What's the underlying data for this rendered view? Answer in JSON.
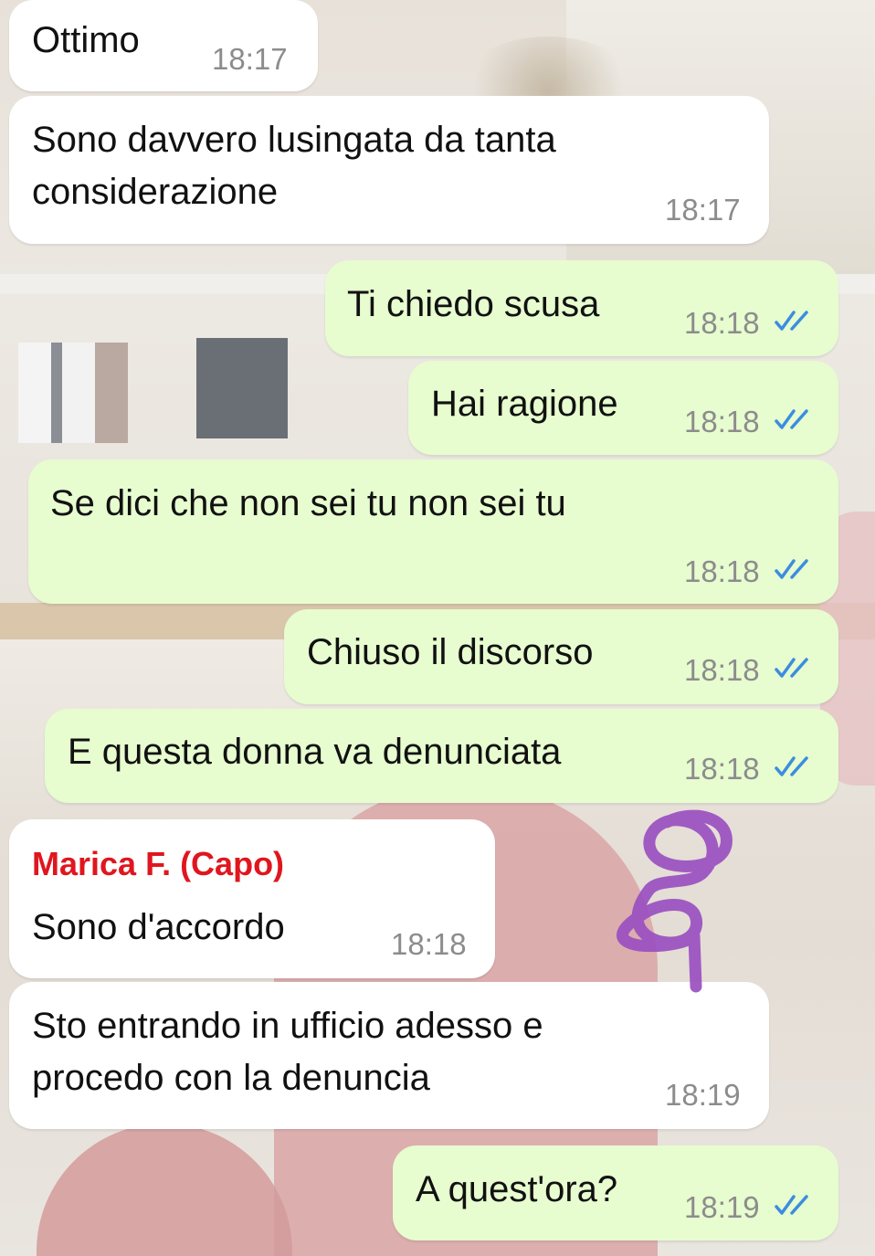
{
  "theme": {
    "incoming_bubble": "#ffffff",
    "outgoing_bubble": "#e7fccf",
    "sender_color": "#e0161f",
    "read_ticks_color": "#3b8de0",
    "scribble_color": "#9a4fc0"
  },
  "messages": [
    {
      "text": "Ottimo",
      "time": "18:17",
      "direction": "incoming"
    },
    {
      "text": "Sono davvero lusingata da tanta\nconsiderazione",
      "time": "18:17",
      "direction": "incoming"
    },
    {
      "text": "Ti chiedo scusa",
      "time": "18:18",
      "direction": "outgoing",
      "status": "read"
    },
    {
      "text": "Hai ragione",
      "time": "18:18",
      "direction": "outgoing",
      "status": "read"
    },
    {
      "text": "Se dici che non sei tu non sei tu",
      "time": "18:18",
      "direction": "outgoing",
      "status": "read"
    },
    {
      "text": "Chiuso il discorso",
      "time": "18:18",
      "direction": "outgoing",
      "status": "read"
    },
    {
      "text": "E questa donna va denunciata",
      "time": "18:18",
      "direction": "outgoing",
      "status": "read"
    },
    {
      "sender": "Marica F. (Capo)",
      "text": "Sono d'accordo",
      "time": "18:18",
      "direction": "incoming"
    },
    {
      "text": "Sto entrando in ufficio adesso e\nprocedo con la denuncia",
      "time": "18:19",
      "direction": "incoming"
    },
    {
      "text": "A quest'ora?",
      "time": "18:19",
      "direction": "outgoing",
      "status": "read"
    }
  ]
}
